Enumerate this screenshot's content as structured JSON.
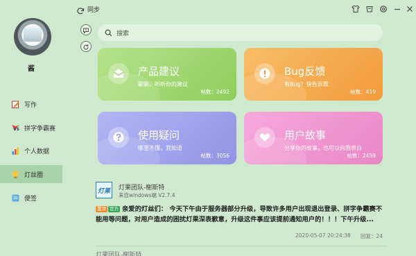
{
  "sidebar": {
    "username": "酱",
    "items": [
      {
        "label": "写作",
        "icon": "write-icon"
      },
      {
        "label": "拼字争霸赛",
        "icon": "versus-icon"
      },
      {
        "label": "个人数据",
        "icon": "chart-icon"
      },
      {
        "label": "灯丝圈",
        "icon": "bulb-icon",
        "active": true
      },
      {
        "label": "便签",
        "icon": "note-icon"
      }
    ]
  },
  "topbar": {
    "sync_label": "同步",
    "buttons": [
      "shirt-icon",
      "skin-icon",
      "settings-icon",
      "minimize-icon",
      "close-icon"
    ]
  },
  "search": {
    "placeholder": "搜索"
  },
  "cards": [
    {
      "title": "产品建议",
      "desc": "聊聊，听听你的建议",
      "count": "帖数：2492",
      "icon": "mail-icon",
      "color": "#9fd66c"
    },
    {
      "title": "Bug反馈",
      "desc": "有Bug？快告诉我",
      "count": "帖数：419",
      "icon": "exclaim-icon",
      "color": "#f5a94e"
    },
    {
      "title": "使用疑问",
      "desc": "哪里不懂，我知道",
      "count": "帖数：3056",
      "icon": "question-icon",
      "color": "#a6a6ee"
    },
    {
      "title": "用户故事",
      "desc": "分享你的故事，也可以向我表白",
      "count": "帖数：2459",
      "icon": "heart-icon",
      "color": "#f09ad0"
    }
  ],
  "post": {
    "avatar_text": "灯果",
    "author": "灯果团队-榭斯特",
    "source": "来自windows端 V2.7.4",
    "badge_top": "置顶",
    "badge_official": "官方",
    "body": "亲爱的灯丝们： 今天下午由于服务器部分升级，导致许多用户出现退出登录、拼字争霸赛不能用等问题，对用户造成的困扰灯果深表歉意，升级这件事应该提前通知用户的！！！下午升级...",
    "time": "2020-05-07 20:24:38",
    "replies": "回复：24"
  },
  "next_post": {
    "author": "灯果团队-榭斯特"
  }
}
